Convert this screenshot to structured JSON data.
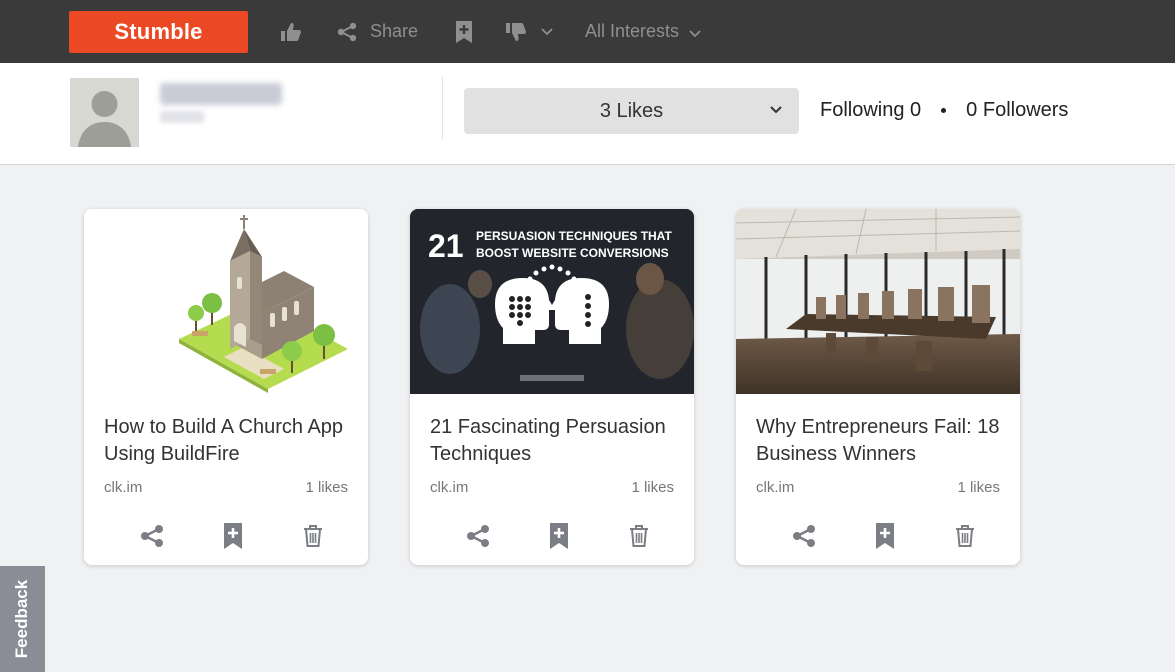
{
  "topbar": {
    "stumble_label": "Stumble",
    "share_label": "Share",
    "interests_label": "All Interests"
  },
  "profile": {
    "likes_selected": "3 Likes",
    "following": "Following 0",
    "followers": "0 Followers"
  },
  "cards": [
    {
      "title": "How to Build A Church App Using BuildFire",
      "source": "clk.im",
      "likes": "1 likes"
    },
    {
      "title": "21 Fascinating Persuasion Techniques",
      "source": "clk.im",
      "likes": "1 likes",
      "thumb_title_num": "21",
      "thumb_title_l1": "Persuasion Techniques That",
      "thumb_title_l2": "Boost Website Conversions"
    },
    {
      "title": "Why Entrepreneurs Fail: 18 Business Winners",
      "source": "clk.im",
      "likes": "1 likes"
    }
  ],
  "feedback_label": "Feedback",
  "colors": {
    "brand": "#eb4924",
    "topbar": "#3a3a3a",
    "icon": "#7b7e84"
  }
}
